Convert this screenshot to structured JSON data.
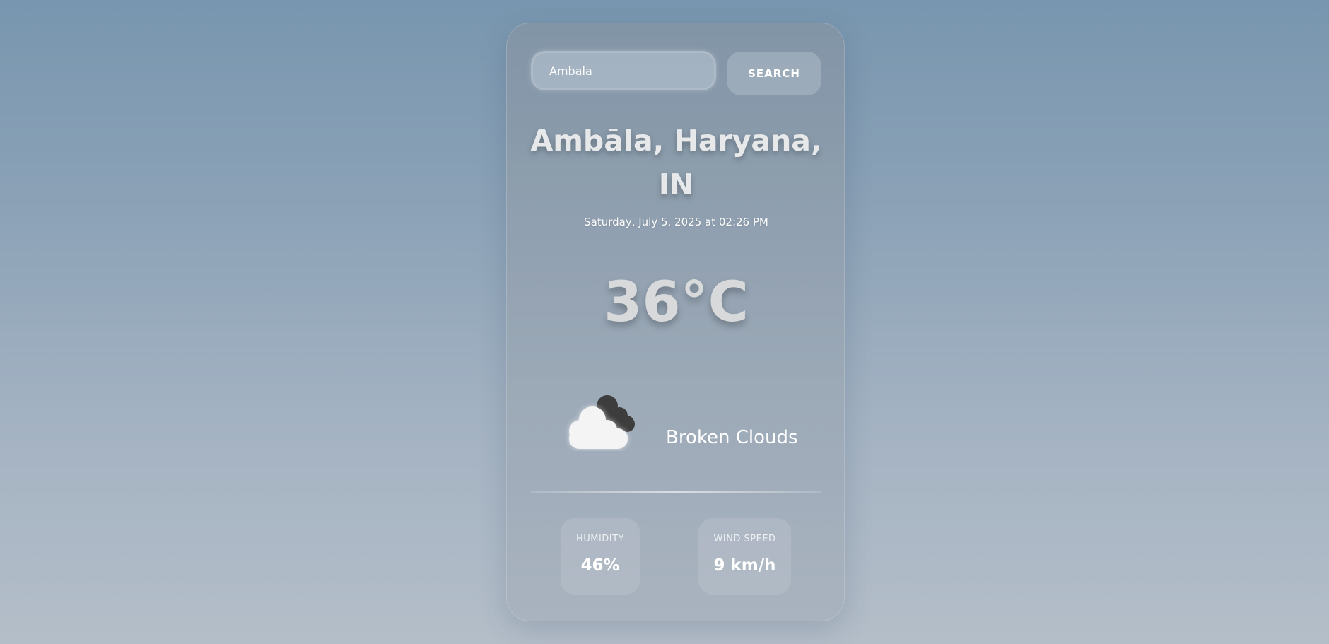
{
  "search": {
    "value": "Ambala",
    "button_label": "SEARCH"
  },
  "location": {
    "city_line": "Ambāla, Haryana, IN",
    "datetime": "Saturday, July 5, 2025 at 02:26 PM"
  },
  "weather": {
    "temperature": "36°C",
    "condition": "Broken Clouds",
    "icon": "broken-clouds-icon"
  },
  "stats": {
    "humidity": {
      "label": "HUMIDITY",
      "value": "46%"
    },
    "wind": {
      "label": "WIND SPEED",
      "value": "9 km/h"
    }
  }
}
